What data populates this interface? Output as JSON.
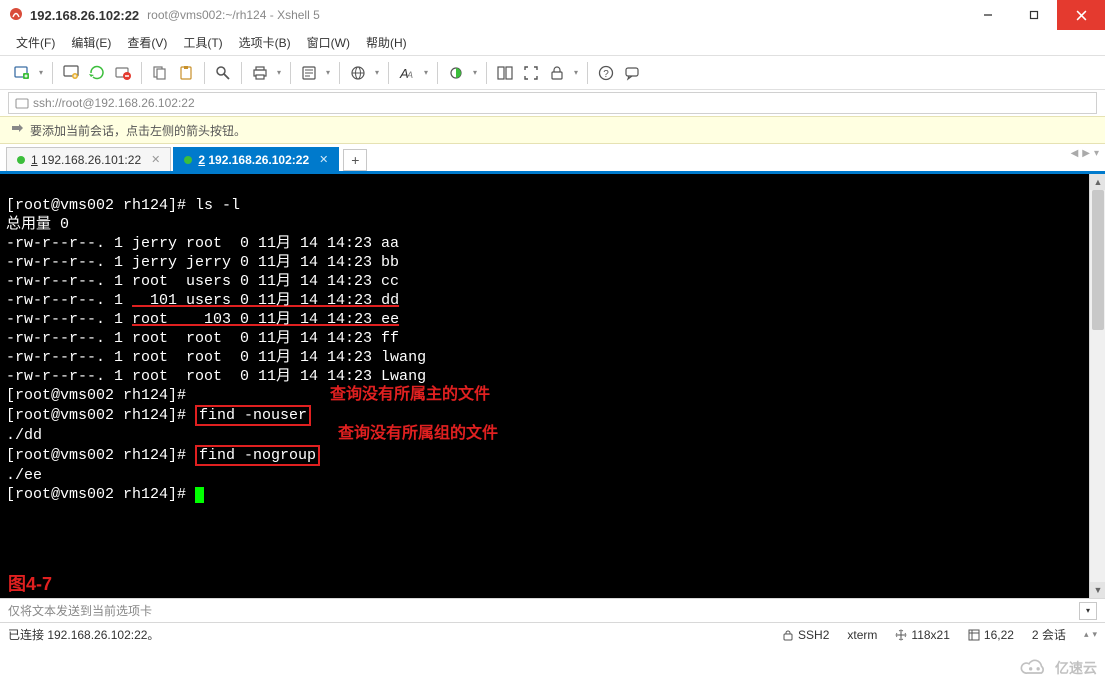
{
  "titlebar": {
    "primary": "192.168.26.102:22",
    "secondary": "root@vms002:~/rh124 - Xshell 5"
  },
  "menu": {
    "file": "文件(F)",
    "edit": "编辑(E)",
    "view": "查看(V)",
    "tools": "工具(T)",
    "tabs": "选项卡(B)",
    "window": "窗口(W)",
    "help": "帮助(H)"
  },
  "toolbar_icons": {
    "new": "new-session-icon",
    "open": "open-icon",
    "reconnect": "reconnect-icon",
    "disconnect": "disconnect-icon",
    "copy": "copy-icon",
    "paste": "paste-icon",
    "find": "find-icon",
    "print": "print-icon",
    "props": "properties-icon",
    "globe": "globe-icon",
    "font": "font-icon",
    "color": "color-icon",
    "split": "split-icon",
    "fullscreen": "fullscreen-icon",
    "lock": "lock-icon",
    "help": "help-icon",
    "msg": "message-icon"
  },
  "addressbar": {
    "url": "ssh://root@192.168.26.102:22"
  },
  "infobar": {
    "text": "要添加当前会话，点击左侧的箭头按钮。"
  },
  "tabs": {
    "tab1_num": "1",
    "tab1_label": " 192.168.26.101:22",
    "tab2_num": "2",
    "tab2_label": " 192.168.26.102:22"
  },
  "terminal": {
    "line01": "[root@vms002 rh124]# ls -l",
    "line02": "总用量 0",
    "line03": "-rw-r--r--. 1 jerry root  0 11月 14 14:23 aa",
    "line04": "-rw-r--r--. 1 jerry jerry 0 11月 14 14:23 bb",
    "line05": "-rw-r--r--. 1 root  users 0 11月 14 14:23 cc",
    "line06a": "-rw-r--r--. 1 ",
    "line06b": "  101 users 0 11月 14 14:23 dd",
    "line07a": "-rw-r--r--. 1 ",
    "line07b": "root    103 0 11月 14 14:23 ee",
    "line08": "-rw-r--r--. 1 root  root  0 11月 14 14:23 ff",
    "line09": "-rw-r--r--. 1 root  root  0 11月 14 14:23 lwang",
    "line10": "-rw-r--r--. 1 root  root  0 11月 14 14:23 Lwang",
    "line11": "[root@vms002 rh124]# ",
    "line12_prompt": "[root@vms002 rh124]# ",
    "line12_cmd": "find -nouser",
    "line13": "./dd",
    "line14_prompt": "[root@vms002 rh124]# ",
    "line14_cmd": "find -nogroup",
    "line15": "./ee",
    "line16_prompt": "[root@vms002 rh124]# ",
    "anno1": "查询没有所属主的文件",
    "anno2": "查询没有所属组的文件",
    "figure_label": "图4-7"
  },
  "sendbar": {
    "placeholder": "仅将文本发送到当前选项卡"
  },
  "statusbar": {
    "conn": "已连接 192.168.26.102:22。",
    "proto": "SSH2",
    "term": "xterm",
    "size": "118x21",
    "cursor": "16,22",
    "sessions": "2 会话"
  },
  "watermark": {
    "text": "亿速云"
  }
}
